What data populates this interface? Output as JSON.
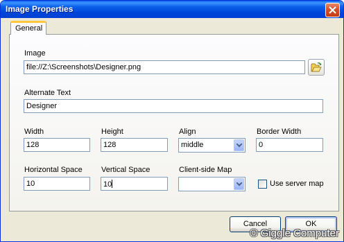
{
  "window": {
    "title": "Image Properties"
  },
  "tabs": [
    {
      "label": "General",
      "active": true
    }
  ],
  "image": {
    "label": "Image",
    "value": "file://Z:\\Screenshots\\Designer.png"
  },
  "alt_text": {
    "label": "Alternate Text",
    "value": "Designer"
  },
  "width": {
    "label": "Width",
    "value": "128"
  },
  "height": {
    "label": "Height",
    "value": "128"
  },
  "align": {
    "label": "Align",
    "value": "middle"
  },
  "border_width": {
    "label": "Border Width",
    "value": "0"
  },
  "horizontal_space": {
    "label": "Horizontal Space",
    "value": "10"
  },
  "vertical_space": {
    "label": "Vertical Space",
    "value": "10"
  },
  "client_side_map": {
    "label": "Client-side Map",
    "value": ""
  },
  "use_server_map": {
    "label": "Use server map",
    "checked": false
  },
  "buttons": {
    "cancel": "Cancel",
    "ok": "OK"
  },
  "watermark": "© Giggle Computer",
  "icons": {
    "close": "close-icon",
    "browse": "folder-open-icon",
    "dropdown": "chevron-down-icon"
  },
  "colors": {
    "titlebar": "#0054e3",
    "dialog_bg": "#ece9d8",
    "tab_highlight": "#ffc83c",
    "field_border": "#7f9db9"
  }
}
